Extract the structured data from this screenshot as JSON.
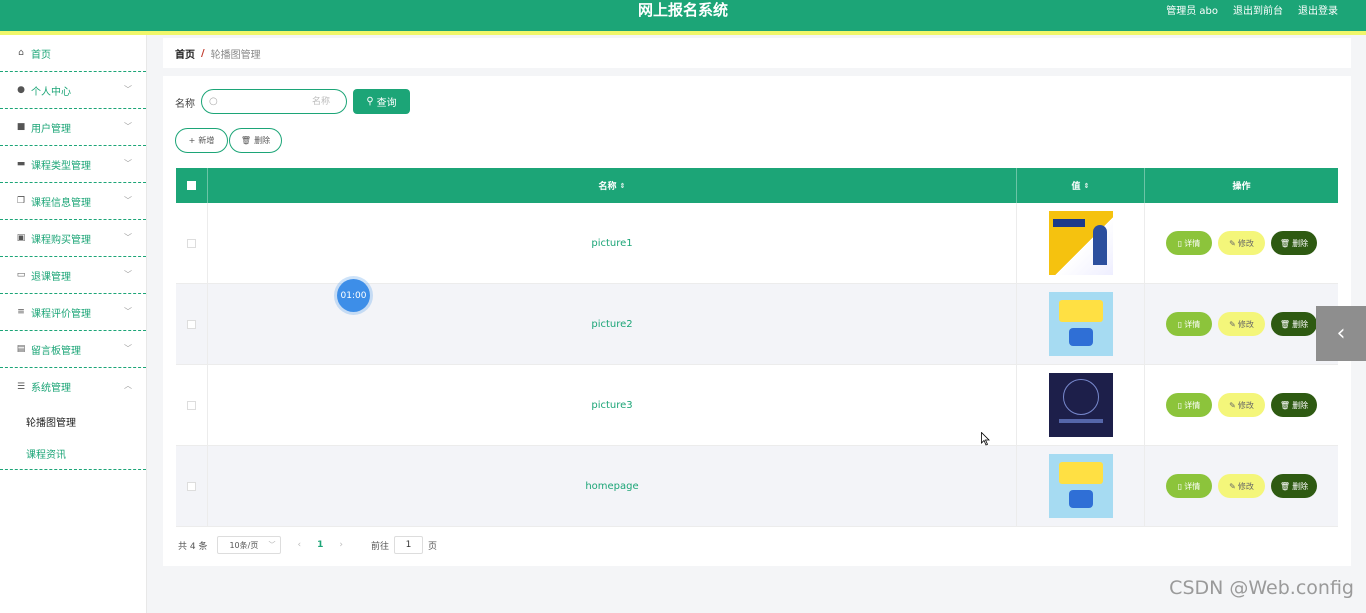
{
  "header": {
    "title": "网上报名系统",
    "user_label": "管理员 abo",
    "front_label": "退出到前台",
    "logout_label": "退出登录",
    "bg_color": "#1ca577",
    "stripe_color": "#f0f76a"
  },
  "sidebar": {
    "items": [
      {
        "label": "首页",
        "icon": "home-icon"
      },
      {
        "label": "个人中心",
        "icon": "user-icon"
      },
      {
        "label": "用户管理",
        "icon": "users-icon"
      },
      {
        "label": "课程类型管理",
        "icon": "chat-icon"
      },
      {
        "label": "课程信息管理",
        "icon": "copy-icon"
      },
      {
        "label": "课程购买管理",
        "icon": "clipboard-icon"
      },
      {
        "label": "退课管理",
        "icon": "message-icon"
      },
      {
        "label": "课程评价管理",
        "icon": "list-icon"
      },
      {
        "label": "留言板管理",
        "icon": "briefcase-icon"
      },
      {
        "label": "系统管理",
        "icon": "sliders-icon"
      }
    ],
    "sub_items": [
      {
        "label": "轮播图管理",
        "active": true
      },
      {
        "label": "课程资讯",
        "active": false
      }
    ]
  },
  "breadcrumb": {
    "home": "首页",
    "separator": "/",
    "current": "轮播图管理"
  },
  "search": {
    "label": "名称",
    "placeholder": "名称",
    "value": "",
    "button_label": "查询"
  },
  "actions": {
    "add_label": "新增",
    "delete_label": "删除"
  },
  "table": {
    "columns": [
      "名称",
      "值",
      "操作"
    ],
    "rows": [
      {
        "name": "picture1",
        "thumb": "thumb-1"
      },
      {
        "name": "picture2",
        "thumb": "thumb-2"
      },
      {
        "name": "picture3",
        "thumb": "thumb-3"
      },
      {
        "name": "homepage",
        "thumb": "thumb-2"
      }
    ],
    "row_actions": {
      "detail": "详情",
      "edit": "修改",
      "delete": "删除"
    }
  },
  "pagination": {
    "total": "共 4 条",
    "page_size": "10条/页",
    "current_page": "1",
    "goto_label": "前往",
    "goto_value": "1",
    "page_unit": "页"
  },
  "overlays": {
    "timer": "01:00",
    "watermark": "CSDN @Web.config"
  }
}
